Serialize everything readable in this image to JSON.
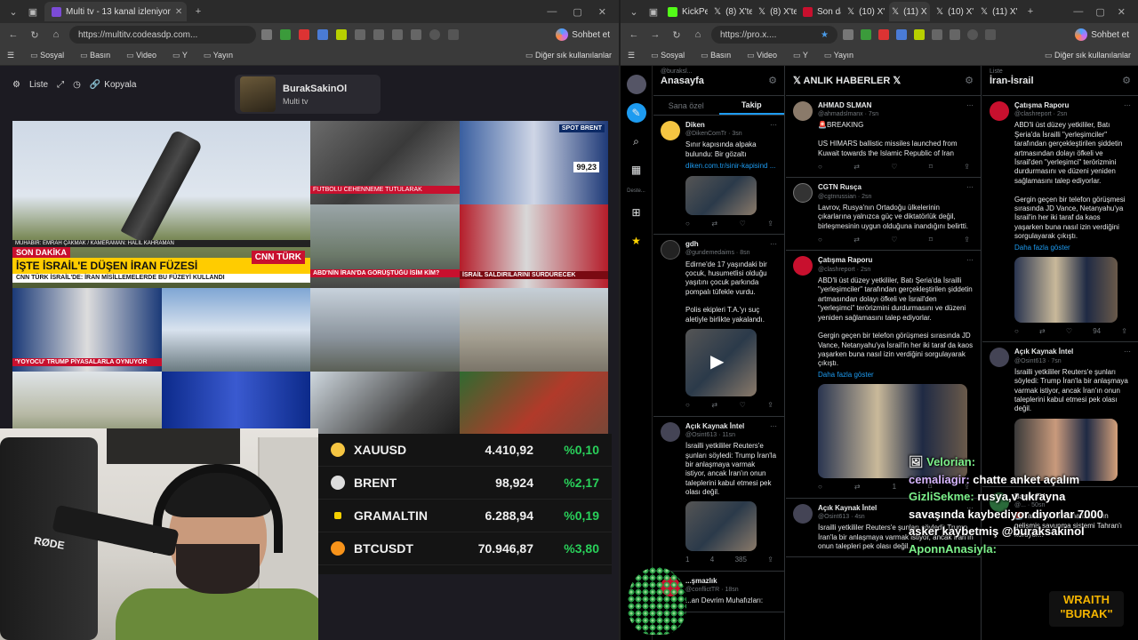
{
  "left_browser": {
    "tab_title": "Multi tv - 13 kanal izleniyor",
    "url": "https://multitv.codeasdp.com...",
    "sohbet": "Sohbet et",
    "favorites": [
      "Sosyal",
      "Basın",
      "Video",
      "Y",
      "Yayın"
    ],
    "favorites_other": "Diğer sık kullanılanlar"
  },
  "multitv": {
    "list_label": "Liste",
    "copy_label": "Kopyala",
    "channel_name": "BurakSakinOl",
    "channel_sub": "Multi tv",
    "main_tile": {
      "muhabir": "MUHABİR: EMRAH ÇAKMAK / KAMERAMAN: HALİL KAHRAMAN",
      "son_dakika": "SON DAKİKA",
      "headline": "İŞTE İSRAİL'E DÜŞEN İRAN FÜZESİ",
      "subline": "CNN TÜRK İSRAİL'DE: İRAN MİSİLLEMELERDE BU FÜZEYİ KULLANDI",
      "cnn": "CNN TÜRK"
    },
    "tiles_text": {
      "t2": "FUTBOLU CEHENNEME TUTULARAK",
      "t3": "SPOT BRENT",
      "t3_price": "99,23",
      "t5": "ABD'NİN İRAN'DA GÖRÜŞTÜĞÜ İSİM KİM?",
      "t6": "İSRAİL SALDIRILARINI SÜRDÜRECEK",
      "t7": "'YOYOCU' TRUMP PİYASALARLA OYNUYOR"
    }
  },
  "ticker": [
    {
      "symbol": "XAUUSD",
      "value": "4.410,92",
      "change": "%0,10",
      "icon_color": "#f5c542"
    },
    {
      "symbol": "BRENT",
      "value": "98,924",
      "change": "%2,17",
      "icon_color": "#dddddd"
    },
    {
      "symbol": "GRAMALTIN",
      "value": "6.288,94",
      "change": "%0,19",
      "icon_color": "#f5d000"
    },
    {
      "symbol": "BTCUSDT",
      "value": "70.946,87",
      "change": "%3,80",
      "icon_color": "#f7931a"
    }
  ],
  "webcam": {
    "mic_brand": "RØDE"
  },
  "right_browser": {
    "tabs": [
      "KickPe",
      "(8) X'te",
      "(8) X'te",
      "Son da",
      "(10) X'",
      "(11) X",
      "(10) X'",
      "(11) X'"
    ],
    "url": "https://pro.x....",
    "sohbet": "Sohbet et",
    "favorites": [
      "Sosyal",
      "Basın",
      "Video",
      "Y",
      "Yayın"
    ],
    "favorites_other": "Diğer sık kullanılanlar"
  },
  "x": {
    "side_label": "Deste...",
    "col1": {
      "pre": "@buraksl...",
      "title": "Anasayfa",
      "subtab1": "Sana özel",
      "subtab2": "Takip",
      "tweets": [
        {
          "name": "Diken",
          "handle": "@DikenComTr · 3sn",
          "text": "Sınır kapısında alpaka bulundu: Bir gözaltı",
          "link": "diken.com.tr/sinir-kapisind ...",
          "acts": [
            "",
            "",
            "",
            ""
          ]
        },
        {
          "name": "gdh",
          "handle": "@gundemedaims · 8sn",
          "text": "Edirne'de 17 yaşındaki bir çocuk, husumetlisi olduğu yaşıtını çocuk parkında pompalı tüfekle vurdu.\n\nPolis ekipleri T.A.'yı suç aletiyle birlikte yakalandı.",
          "acts": [
            "",
            "",
            "",
            ""
          ]
        },
        {
          "name": "Açık Kaynak İntel",
          "handle": "@Osint613 · 11sn",
          "text": "İsrailli yetkililer Reuters'e şunları söyledi: Trump İran'la bir anlaşmaya varmak istiyor, ancak İran'ın onun taleplerini kabul etmesi pek olası değil.",
          "acts": [
            "1",
            "4",
            "385",
            ""
          ]
        },
        {
          "name": "...şmazlık",
          "handle": "@conflictTR · 18sn",
          "text": "...an Devrim Muhafızları:"
        }
      ]
    },
    "col2": {
      "title": "𝕏 ANLIK HABERLER 𝕏",
      "tweets": [
        {
          "name": "AHMAD SLMAN",
          "handle": "@ahmadslmanx · 7sn",
          "text": "🚨BREAKING\n\nUS HIMARS ballistic missiles launched from Kuwait towards the Islamic Republic of Iran",
          "acts": [
            "",
            "",
            "",
            ""
          ]
        },
        {
          "name": "CGTN Rusça",
          "handle": "@cgtnrussian · 2sn",
          "text": "Lavrov, Rusya'nın Ortadoğu ülkelerinin çıkarlarına yalnızca güç ve diktatörlük değil, birleşmesinin uygun olduğuna inandığını belirtti.",
          "acts": [
            "",
            "",
            "",
            ""
          ]
        },
        {
          "name": "Çatışma Raporu",
          "handle": "@clashreport · 2sn",
          "text": "ABD'li üst düzey yetkililer, Batı Şeria'da İsrailli \"yerleşimciler\" tarafından gerçekleştirilen şiddetin artmasından dolayı öfkeli ve İsrail'den \"yerleşimci\" terörizmini durdurmasını ve düzeni yeniden sağlamasını talep ediyorlar.\n\nGergin geçen bir telefon görüşmesi sırasında JD Vance, Netanyahu'ya İsrail'in her iki taraf da kaos yaşarken buna nasıl izin verdiğini sorgulayarak çıkıştı.",
          "more": "Daha fazla göster",
          "acts": [
            "",
            "",
            "1",
            ""
          ]
        },
        {
          "name": "Açık Kaynak İntel",
          "handle": "@Osint613 · 4sn",
          "text": "İsrailli yetkililer Reuters'e şunları söyledi: Trump İran'la bir anlaşmaya varmak istiyor, ancak İran'ın onun talepleri pek olası değil."
        }
      ]
    },
    "col3": {
      "pre": "Liste",
      "title": "İran-İsrail",
      "tweets": [
        {
          "name": "Çatışma Raporu",
          "handle": "@clashreport · 2sn",
          "text": "ABD'li üst düzey yetkililer, Batı Şeria'da İsrailli \"yerleşimciler\" tarafından gerçekleştirilen şiddetin artmasından dolayı öfkeli ve İsrail'den \"yerleşimci\" terörizmini durdurmasını ve düzeni yeniden sağlamasını talep ediyorlar.\n\nGergin geçen bir telefon görüşmesi sırasında JD Vance, Netanyahu'ya İsrail'in her iki taraf da kaos yaşarken buna nasıl izin verdiğini sorgulayarak çıkıştı.",
          "more": "Daha fazla göster",
          "acts": [
            "",
            "",
            "94",
            ""
          ]
        },
        {
          "name": "Açık Kaynak İntel",
          "handle": "@Osint613 · 7sn",
          "text": "İsrailli yetkililer Reuters'e şunları söyledi: Trump İran'la bir anlaşmaya varmak istiyor, ancak İran'ın onun taleplerini kabul etmesi pek olası değil."
        },
        {
          "name": "Basın TV",
          "handle": "@... · 50sn",
          "text": "🚨İran Devrim Muhafızları'nın gelişmiş savunma sistemi Tahran'ı koruyor..."
        }
      ]
    }
  },
  "chat": [
    {
      "user": "Velorian:",
      "msg": ""
    },
    {
      "user": "cemaliagir:",
      "msg": "chatte anket açalım"
    },
    {
      "user": "GizliSekme:",
      "msg": "rusya,v ukrayna savaşında kaybediyor diyorlar 7000 asker kaybetmiş @buraksakinol"
    },
    {
      "user": "AponnAnasiyla:",
      "msg": ""
    }
  ],
  "wraith": {
    "line1": "WRAITH",
    "line2": "\"BURAK\""
  },
  "colors": {
    "accent_x": "#1d9bf0",
    "ticker_green": "#29d05a",
    "cnn_red": "#c8102e"
  }
}
